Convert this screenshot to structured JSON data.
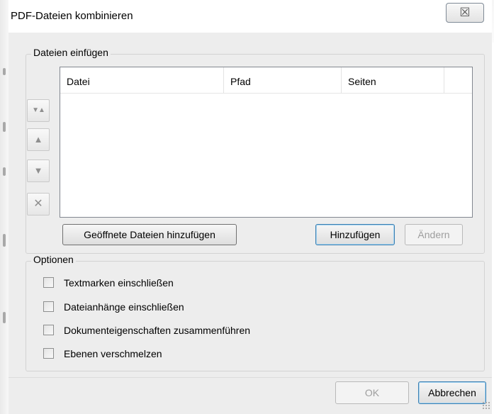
{
  "window": {
    "title": "PDF-Dateien kombinieren",
    "close_glyph": "☒"
  },
  "files_group": {
    "legend": "Dateien einfügen",
    "columns": [
      "Datei",
      "Pfad",
      "Seiten",
      ""
    ],
    "rows": []
  },
  "side_buttons": {
    "top_glyph": "▼▲",
    "up_glyph": "▲",
    "down_glyph": "▼",
    "remove_glyph": "✕"
  },
  "file_buttons": {
    "add_open_label": "Geöffnete Dateien hinzufügen",
    "add_label": "Hinzufügen",
    "change_label": "Ändern"
  },
  "options_group": {
    "legend": "Optionen",
    "checkboxes": [
      {
        "label": "Textmarken einschließen",
        "checked": false
      },
      {
        "label": "Dateianhänge einschließen",
        "checked": false
      },
      {
        "label": "Dokumenteigenschaften zusammenführen",
        "checked": false
      },
      {
        "label": "Ebenen verschmelzen",
        "checked": false
      }
    ]
  },
  "footer": {
    "ok_label": "OK",
    "cancel_label": "Abbrechen"
  },
  "colors": {
    "dialog_bg": "#ededed",
    "focus_border": "#3c7fb1",
    "disabled_text": "#9e9e9e"
  }
}
